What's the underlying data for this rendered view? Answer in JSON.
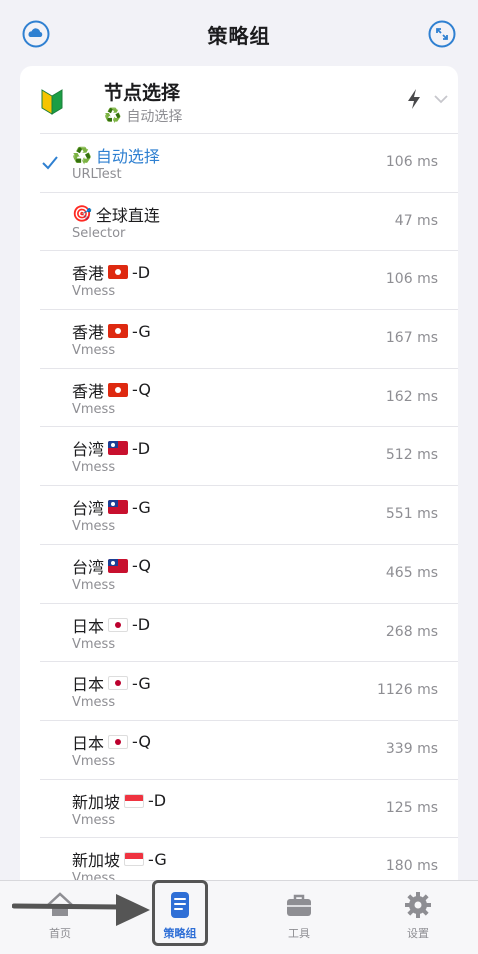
{
  "nav": {
    "title": "策略组",
    "left_icon": "cloud-icon",
    "right_icon": "expand-icon"
  },
  "group": {
    "title": "节点选择",
    "subtitle": "自动选择",
    "icon": "beginner-leaf-icon",
    "actions": [
      "bolt-icon",
      "chevron-down-icon"
    ]
  },
  "proxies": [
    {
      "prefix": "♻️",
      "label": "自动选择",
      "flag": "",
      "suffix": "",
      "type": "URLTest",
      "latency": "106 ms",
      "selected": true
    },
    {
      "prefix": "🎯",
      "label": "全球直连",
      "flag": "",
      "suffix": "",
      "type": "Selector",
      "latency": "47 ms",
      "selected": false
    },
    {
      "prefix": "",
      "label": "香港",
      "flag": "hk",
      "suffix": "-D",
      "type": "Vmess",
      "latency": "106 ms",
      "selected": false
    },
    {
      "prefix": "",
      "label": "香港",
      "flag": "hk",
      "suffix": "-G",
      "type": "Vmess",
      "latency": "167 ms",
      "selected": false
    },
    {
      "prefix": "",
      "label": "香港",
      "flag": "hk",
      "suffix": "-Q",
      "type": "Vmess",
      "latency": "162 ms",
      "selected": false
    },
    {
      "prefix": "",
      "label": "台湾",
      "flag": "tw",
      "suffix": "-D",
      "type": "Vmess",
      "latency": "512 ms",
      "selected": false
    },
    {
      "prefix": "",
      "label": "台湾",
      "flag": "tw",
      "suffix": "-G",
      "type": "Vmess",
      "latency": "551 ms",
      "selected": false
    },
    {
      "prefix": "",
      "label": "台湾",
      "flag": "tw",
      "suffix": "-Q",
      "type": "Vmess",
      "latency": "465 ms",
      "selected": false
    },
    {
      "prefix": "",
      "label": "日本",
      "flag": "jp",
      "suffix": "-D",
      "type": "Vmess",
      "latency": "268 ms",
      "selected": false
    },
    {
      "prefix": "",
      "label": "日本",
      "flag": "jp",
      "suffix": "-G",
      "type": "Vmess",
      "latency": "1126 ms",
      "selected": false
    },
    {
      "prefix": "",
      "label": "日本",
      "flag": "jp",
      "suffix": "-Q",
      "type": "Vmess",
      "latency": "339 ms",
      "selected": false
    },
    {
      "prefix": "",
      "label": "新加坡",
      "flag": "sg",
      "suffix": "-D",
      "type": "Vmess",
      "latency": "125 ms",
      "selected": false
    },
    {
      "prefix": "",
      "label": "新加坡",
      "flag": "sg",
      "suffix": "-G",
      "type": "Vmess",
      "latency": "180 ms",
      "selected": false
    }
  ],
  "tabs": [
    {
      "label": "首页",
      "icon": "home-icon",
      "active": false
    },
    {
      "label": "策略组",
      "icon": "policy-list-icon",
      "active": true
    },
    {
      "label": "工具",
      "icon": "toolbox-icon",
      "active": false
    },
    {
      "label": "设置",
      "icon": "gear-icon",
      "active": false
    }
  ],
  "colors": {
    "accent": "#2f80d1",
    "tab_active": "#2f6fd6",
    "secondary_text": "#8e8e93",
    "background": "#f2f2f7"
  }
}
